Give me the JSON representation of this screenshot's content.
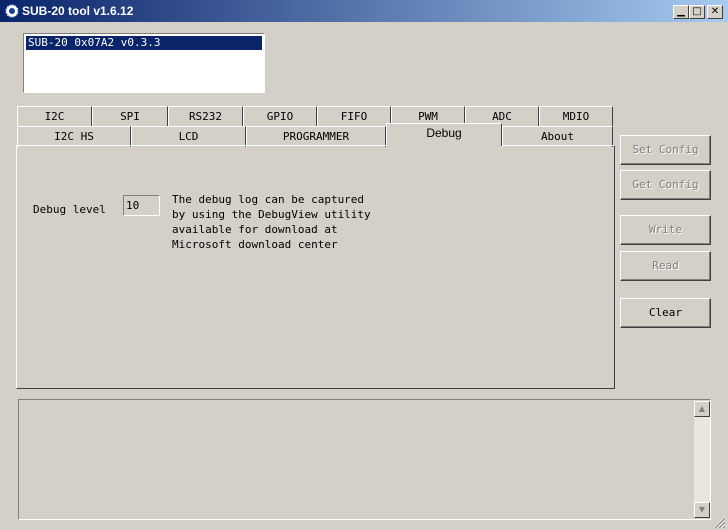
{
  "window": {
    "title": "SUB-20 tool v1.6.12"
  },
  "device_list": {
    "items": [
      "SUB-20 0x07A2 v0.3.3"
    ]
  },
  "tabs": {
    "row1": [
      "I2C",
      "SPI",
      "RS232",
      "GPIO",
      "FIFO",
      "PWM",
      "ADC",
      "MDIO"
    ],
    "row2": [
      "I2C HS",
      "LCD",
      "PROGRAMMER",
      "Debug",
      "About"
    ],
    "selected": "Debug"
  },
  "debug": {
    "level_label": "Debug level",
    "level_value": "10",
    "info_lines": [
      "The debug log can be captured",
      "by using the DebugView utility",
      "available for download at",
      "Microsoft download center"
    ]
  },
  "buttons": {
    "set_config": "Set Config",
    "get_config": "Get Config",
    "write": "Write",
    "read": "Read",
    "clear": "Clear"
  },
  "colors": {
    "titlebar": "#0a246a",
    "selection": "#0a246a",
    "face": "#d4d0c8"
  }
}
